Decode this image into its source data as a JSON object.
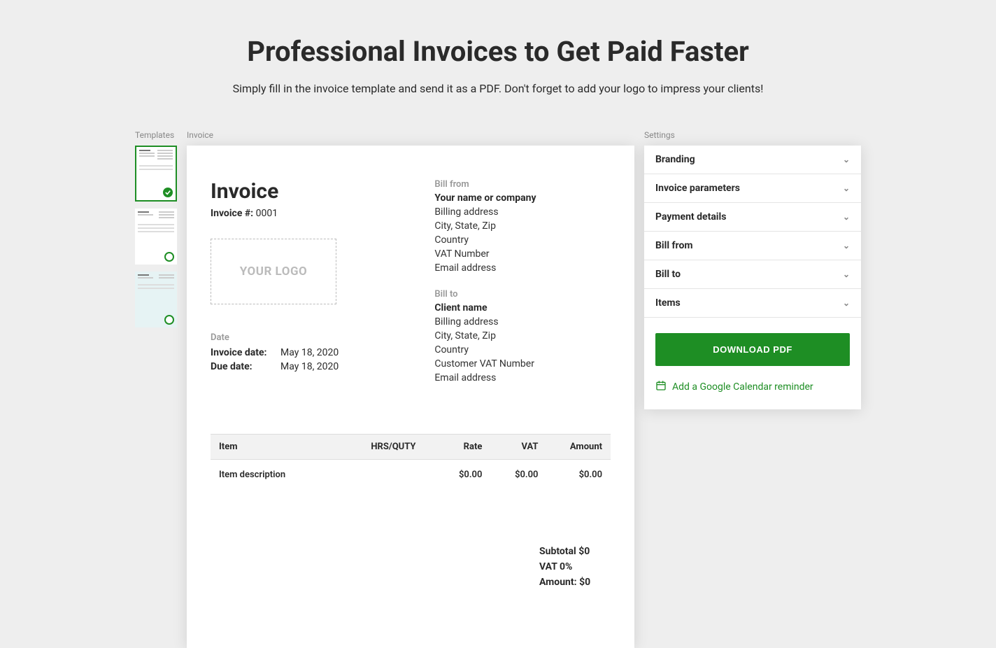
{
  "hero": {
    "title": "Professional Invoices to Get Paid Faster",
    "subtitle": "Simply fill in the invoice template and send it as a PDF. Don't forget to add your logo to impress your clients!"
  },
  "labels": {
    "templates": "Templates",
    "invoice": "Invoice",
    "settings": "Settings"
  },
  "invoice": {
    "title": "Invoice",
    "number_label": "Invoice #:",
    "number": "0001",
    "logo_placeholder": "YOUR LOGO",
    "date_section_label": "Date",
    "invoice_date_label": "Invoice date:",
    "invoice_date": "May 18, 2020",
    "due_date_label": "Due date:",
    "due_date": "May 18, 2020",
    "bill_from": {
      "label": "Bill from",
      "name": "Your name or company",
      "address": "Billing address",
      "city": "City, State, Zip",
      "country": "Country",
      "vat": "VAT Number",
      "email": "Email address"
    },
    "bill_to": {
      "label": "Bill to",
      "name": "Client name",
      "address": "Billing address",
      "city": "City, State, Zip",
      "country": "Country",
      "vat": "Customer VAT Number",
      "email": "Email address"
    },
    "table": {
      "headers": {
        "item": "Item",
        "qty": "HRS/QUTY",
        "rate": "Rate",
        "vat": "VAT",
        "amount": "Amount"
      },
      "rows": [
        {
          "item": "Item description",
          "qty": "",
          "rate": "$0.00",
          "vat": "$0.00",
          "amount": "$0.00"
        }
      ]
    },
    "totals": {
      "subtotal": "Subtotal $0",
      "vat": "VAT 0%",
      "amount": "Amount: $0"
    }
  },
  "settings": {
    "sections": [
      "Branding",
      "Invoice parameters",
      "Payment details",
      "Bill from",
      "Bill to",
      "Items"
    ],
    "download_label": "DOWNLOAD PDF",
    "reminder_label": "Add a Google Calendar reminder"
  }
}
